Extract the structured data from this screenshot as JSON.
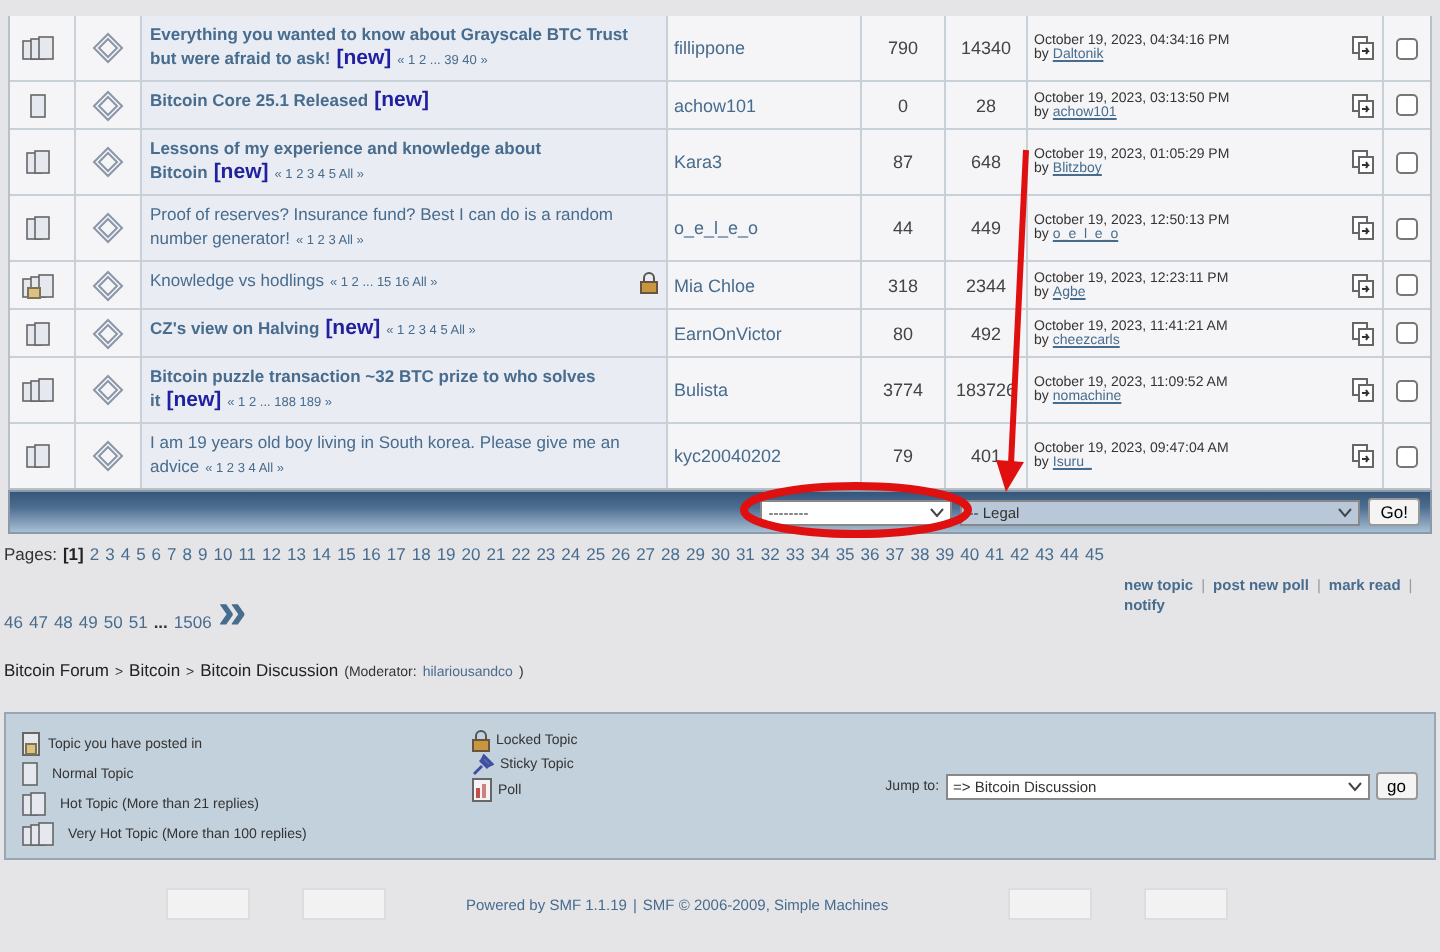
{
  "topics": [
    {
      "kind": "very_hot",
      "title": "Everything you wanted to know about Grayscale BTC Trust but were afraid to ask!",
      "unread": true,
      "new_label": "[new]",
      "pages": "« 1 2 ... 39 40 »",
      "locked": false,
      "starter": "fillippone",
      "replies": "790",
      "views": "14340",
      "last_date": "October 19, 2023, 04:34:16 PM",
      "by_label": "by",
      "last_by": "Daltonik",
      "checked": false
    },
    {
      "kind": "normal",
      "title": "Bitcoin Core 25.1 Released",
      "unread": true,
      "new_label": "[new]",
      "locked": false,
      "starter": "achow101",
      "replies": "0",
      "views": "28",
      "last_date": "October 19, 2023, 03:13:50 PM",
      "by_label": "by",
      "last_by": "achow101",
      "checked": false
    },
    {
      "kind": "hot",
      "title": "Lessons of my experience and knowledge about Bitcoin",
      "unread": true,
      "new_label": "[new]",
      "pages": "« 1 2 3 4 5  All »",
      "locked": false,
      "starter": "Kara3",
      "replies": "87",
      "views": "648",
      "last_date": "October 19, 2023, 01:05:29 PM",
      "by_label": "by",
      "last_by": "Blitzboy",
      "checked": false
    },
    {
      "kind": "hot",
      "title": "Proof of reserves? Insurance fund? Best I can do is a random number generator!",
      "unread": false,
      "pages": "« 1 2 3  All »",
      "locked": false,
      "starter": "o_e_l_e_o",
      "replies": "44",
      "views": "449",
      "last_date": "October 19, 2023, 12:50:13 PM",
      "by_label": "by",
      "last_by": "o_e_l_e_o",
      "checked": false
    },
    {
      "kind": "very_hot_posted",
      "title": "Knowledge vs hodlings",
      "unread": false,
      "pages": "« 1 2 ... 15 16  All »",
      "locked": true,
      "starter": "Mia Chloe",
      "replies": "318",
      "views": "2344",
      "last_date": "October 19, 2023, 12:23:11 PM",
      "by_label": "by",
      "last_by": "Agbe",
      "checked": false
    },
    {
      "kind": "hot",
      "title": "CZ's view on Halving",
      "unread": true,
      "new_label": "[new]",
      "pages": "« 1 2 3 4 5  All »",
      "locked": false,
      "starter": "EarnOnVictor",
      "replies": "80",
      "views": "492",
      "last_date": "October 19, 2023, 11:41:21 AM",
      "by_label": "by",
      "last_by": "cheezcarls",
      "checked": false
    },
    {
      "kind": "very_hot",
      "title": "Bitcoin puzzle transaction ~32 BTC prize to who solves it",
      "unread": true,
      "new_label": "[new]",
      "pages": "« 1 2 ... 188 189 »",
      "locked": false,
      "starter": "Bulista",
      "replies": "3774",
      "views": "183726",
      "last_date": "October 19, 2023, 11:09:52 AM",
      "by_label": "by",
      "last_by": "nomachine",
      "checked": false
    },
    {
      "kind": "hot",
      "title": "I am 19 years old boy living in South korea. Please give me an advice",
      "unread": false,
      "pages": "« 1 2 3 4  All »",
      "locked": false,
      "starter": "kyc20040202",
      "replies": "79",
      "views": "401",
      "last_date": "October 19, 2023, 09:47:04 AM",
      "by_label": "by",
      "last_by": "Isuru_",
      "checked": false
    }
  ],
  "moderation": {
    "action_select": "--------",
    "move_select": "-- Legal",
    "go_button": "Go!"
  },
  "pagination": {
    "label": "Pages:",
    "pages": [
      {
        "label": "[1]",
        "selected": true
      },
      {
        "label": "2",
        "selected": false
      },
      {
        "label": "3",
        "selected": false
      },
      {
        "label": "4",
        "selected": false
      },
      {
        "label": "5",
        "selected": false
      },
      {
        "label": "6",
        "selected": false
      },
      {
        "label": "7",
        "selected": false
      },
      {
        "label": "8",
        "selected": false
      },
      {
        "label": "9",
        "selected": false
      },
      {
        "label": "10",
        "selected": false
      },
      {
        "label": "11",
        "selected": false
      },
      {
        "label": "12",
        "selected": false
      },
      {
        "label": "13",
        "selected": false
      },
      {
        "label": "14",
        "selected": false
      },
      {
        "label": "15",
        "selected": false
      },
      {
        "label": "16",
        "selected": false
      },
      {
        "label": "17",
        "selected": false
      },
      {
        "label": "18",
        "selected": false
      },
      {
        "label": "19",
        "selected": false
      },
      {
        "label": "20",
        "selected": false
      },
      {
        "label": "21",
        "selected": false
      },
      {
        "label": "22",
        "selected": false
      },
      {
        "label": "23",
        "selected": false
      },
      {
        "label": "24",
        "selected": false
      },
      {
        "label": "25",
        "selected": false
      },
      {
        "label": "26",
        "selected": false
      },
      {
        "label": "27",
        "selected": false
      },
      {
        "label": "28",
        "selected": false
      },
      {
        "label": "29",
        "selected": false
      },
      {
        "label": "30",
        "selected": false
      },
      {
        "label": "31",
        "selected": false
      },
      {
        "label": "32",
        "selected": false
      },
      {
        "label": "33",
        "selected": false
      },
      {
        "label": "34",
        "selected": false
      },
      {
        "label": "35",
        "selected": false
      },
      {
        "label": "36",
        "selected": false
      },
      {
        "label": "37",
        "selected": false
      },
      {
        "label": "38",
        "selected": false
      },
      {
        "label": "39",
        "selected": false
      },
      {
        "label": "40",
        "selected": false
      },
      {
        "label": "41",
        "selected": false
      },
      {
        "label": "42",
        "selected": false
      },
      {
        "label": "43",
        "selected": false
      },
      {
        "label": "44",
        "selected": false
      },
      {
        "label": "45",
        "selected": false
      },
      {
        "label": "46",
        "selected": false
      },
      {
        "label": "47",
        "selected": false
      },
      {
        "label": "48",
        "selected": false
      },
      {
        "label": "49",
        "selected": false
      },
      {
        "label": "50",
        "selected": false
      },
      {
        "label": "51",
        "selected": false
      }
    ],
    "ellipsis": "...",
    "last": "1506",
    "next": "»"
  },
  "actions": {
    "links": [
      "new topic",
      "post new poll",
      "mark read",
      "notify"
    ],
    "separator": "|"
  },
  "breadcrumb": {
    "items": [
      "Bitcoin Forum",
      "Bitcoin",
      "Bitcoin Discussion"
    ],
    "separator": ">",
    "moderator_label": "(Moderator:",
    "moderator": "hilariousandco",
    "close": ")"
  },
  "legend": [
    {
      "kind": "posted",
      "label": "Topic you have posted in"
    },
    {
      "kind": "normal",
      "label": "Normal Topic"
    },
    {
      "kind": "hot",
      "label": "Hot Topic (More than 21 replies)"
    },
    {
      "kind": "very_hot",
      "label": "Very Hot Topic (More than 100 replies)"
    },
    {
      "kind": "locked",
      "label": "Locked Topic"
    },
    {
      "kind": "sticky",
      "label": "Sticky Topic"
    },
    {
      "kind": "poll",
      "label": "Poll"
    }
  ],
  "jump": {
    "label": "Jump to:",
    "value": "=> Bitcoin Discussion",
    "button": "go"
  },
  "footer": {
    "powered": "Powered by SMF 1.1.19",
    "sep": "|",
    "copyright": "SMF © 2006-2009, Simple Machines"
  }
}
